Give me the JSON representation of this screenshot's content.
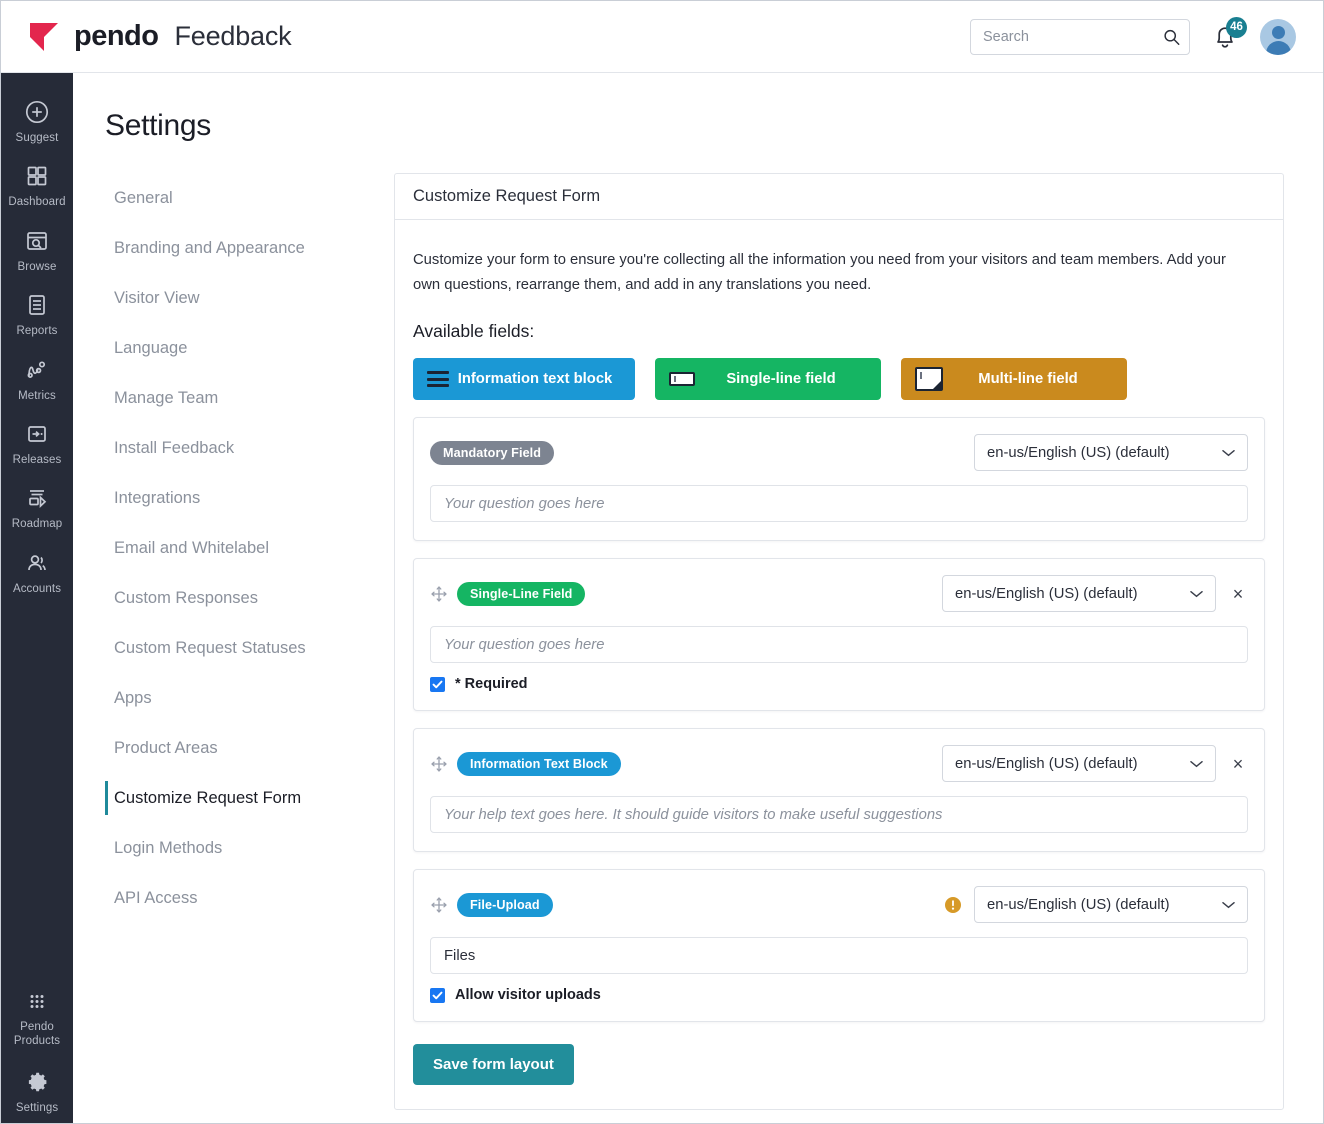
{
  "header": {
    "brand_name": "pendo",
    "brand_app": "Feedback",
    "search": {
      "value": "",
      "placeholder": "Search"
    },
    "notifications_count": "46"
  },
  "rail": {
    "items": [
      {
        "icon": "plus-circle-icon",
        "label": "Suggest"
      },
      {
        "icon": "dashboard-grid-icon",
        "label": "Dashboard"
      },
      {
        "icon": "browse-search-icon",
        "label": "Browse"
      },
      {
        "icon": "reports-document-icon",
        "label": "Reports"
      },
      {
        "icon": "metrics-chart-icon",
        "label": "Metrics"
      },
      {
        "icon": "releases-arrow-icon",
        "label": "Releases"
      },
      {
        "icon": "roadmap-icon",
        "label": "Roadmap"
      },
      {
        "icon": "accounts-people-icon",
        "label": "Accounts"
      }
    ],
    "bottom": [
      {
        "icon": "pendo-products-grid-icon",
        "label": "Pendo\nProducts"
      },
      {
        "icon": "gear-icon",
        "label": "Settings"
      }
    ]
  },
  "page": {
    "title": "Settings",
    "settings_nav": [
      {
        "label": "General",
        "active": false
      },
      {
        "label": "Branding and Appearance",
        "active": false
      },
      {
        "label": "Visitor View",
        "active": false
      },
      {
        "label": "Language",
        "active": false
      },
      {
        "label": "Manage Team",
        "active": false
      },
      {
        "label": "Install Feedback",
        "active": false
      },
      {
        "label": "Integrations",
        "active": false
      },
      {
        "label": "Email and Whitelabel",
        "active": false
      },
      {
        "label": "Custom Responses",
        "active": false
      },
      {
        "label": "Custom Request Statuses",
        "active": false
      },
      {
        "label": "Apps",
        "active": false
      },
      {
        "label": "Product Areas",
        "active": false
      },
      {
        "label": "Customize Request Form",
        "active": true
      },
      {
        "label": "Login Methods",
        "active": false
      },
      {
        "label": "API Access",
        "active": false
      }
    ]
  },
  "card": {
    "title": "Customize Request Form",
    "description": "Customize your form to ensure you're collecting all the information you need from your visitors and team members. Add your own questions, rearrange them, and add in any translations you need.",
    "available_fields_label": "Available fields:",
    "type_buttons": [
      {
        "label": "Information text block",
        "color": "#1b98d5",
        "icon": "text-lines-icon"
      },
      {
        "label": "Single-line field",
        "color": "#15b563",
        "icon": "single-line-input-icon"
      },
      {
        "label": "Multi-line field",
        "color": "#ca8a1e",
        "icon": "multi-line-input-icon"
      }
    ],
    "fields": [
      {
        "pill_label": "Mandatory Field",
        "pill_color": "#7d8491",
        "language": "en-us/English (US) (default)",
        "question_placeholder": "Your question goes here",
        "question_value": "",
        "has_drag_handle": false,
        "has_remove": false,
        "has_warning": false,
        "checkbox": null
      },
      {
        "pill_label": "Single-Line Field",
        "pill_color": "#15b563",
        "language": "en-us/English (US) (default)",
        "question_placeholder": "Your question goes here",
        "question_value": "",
        "has_drag_handle": true,
        "has_remove": true,
        "has_warning": false,
        "checkbox": {
          "label": "* Required",
          "checked": true
        }
      },
      {
        "pill_label": "Information Text Block",
        "pill_color": "#1b98d5",
        "language": "en-us/English (US) (default)",
        "question_placeholder": "Your help text goes here. It should guide visitors to make useful suggestions",
        "question_value": "",
        "has_drag_handle": true,
        "has_remove": true,
        "has_warning": false,
        "checkbox": null
      },
      {
        "pill_label": "File-Upload",
        "pill_color": "#1b98d5",
        "language": "en-us/English (US) (default)",
        "question_placeholder": "",
        "question_value": "Files",
        "has_drag_handle": true,
        "has_remove": false,
        "has_warning": true,
        "checkbox": {
          "label": "Allow visitor uploads",
          "checked": true
        }
      }
    ],
    "save_label": "Save form layout",
    "remove_label": "×"
  },
  "colors": {
    "accent_teal": "#228e9b",
    "brand_red": "#e3264d",
    "blue": "#1b98d5",
    "green": "#15b563",
    "amber": "#ca8a1e",
    "gray_pill": "#7d8491",
    "checkbox_blue": "#1877f2",
    "rail_bg": "#262b38",
    "badge_teal": "#197f91"
  }
}
